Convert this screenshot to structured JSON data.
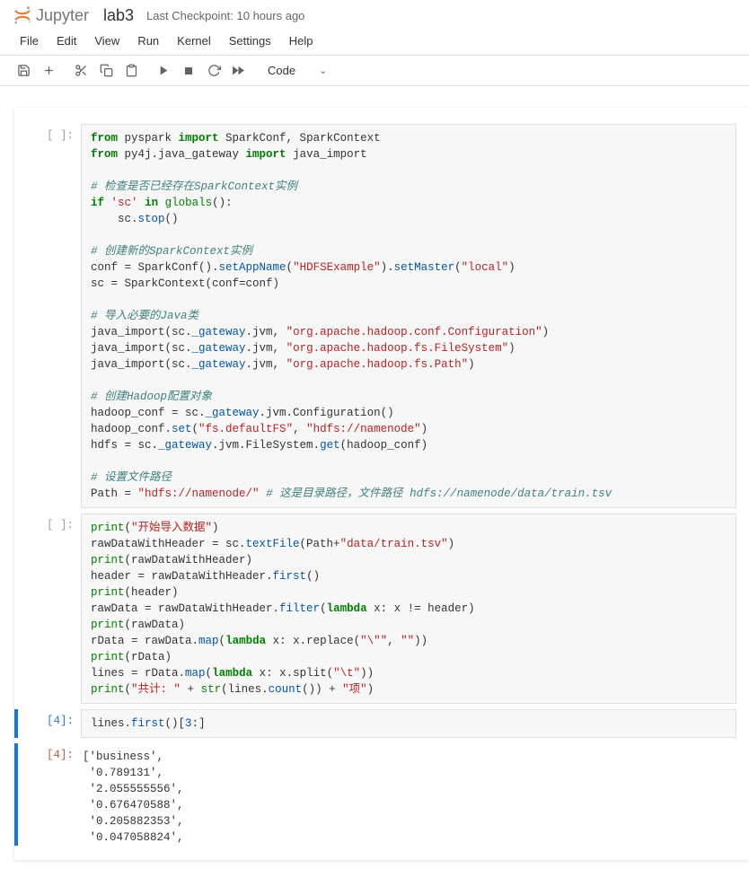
{
  "header": {
    "brand": "Jupyter",
    "doc_title": "lab3",
    "checkpoint": "Last Checkpoint: 10 hours ago"
  },
  "menu": {
    "file": "File",
    "edit": "Edit",
    "view": "View",
    "run": "Run",
    "kernel": "Kernel",
    "settings": "Settings",
    "help": "Help"
  },
  "toolbar": {
    "save": "💾",
    "add": "＋",
    "cut": "✂",
    "copy": "⧉",
    "paste": "📋",
    "run": "▶",
    "stop": "■",
    "restart": "⟳",
    "ff": "▶▶",
    "cell_type": "Code",
    "chevron": "⌄"
  },
  "cells": [
    {
      "prompt": "[ ]:",
      "type": "code",
      "lines": [
        [
          [
            "kw",
            "from"
          ],
          [
            "p",
            " pyspark "
          ],
          [
            "kw",
            "import"
          ],
          [
            "p",
            " SparkConf, SparkContext"
          ]
        ],
        [
          [
            "kw",
            "from"
          ],
          [
            "p",
            " py4j.java_gateway "
          ],
          [
            "kw",
            "import"
          ],
          [
            "p",
            " java_import"
          ]
        ],
        [
          [
            "p",
            ""
          ]
        ],
        [
          [
            "cm",
            "# 检查是否已经存在SparkContext实例"
          ]
        ],
        [
          [
            "kw",
            "if"
          ],
          [
            "p",
            " "
          ],
          [
            "str",
            "'sc'"
          ],
          [
            "p",
            " "
          ],
          [
            "kw",
            "in"
          ],
          [
            "p",
            " "
          ],
          [
            "builtin",
            "globals"
          ],
          [
            "p",
            "():"
          ]
        ],
        [
          [
            "p",
            "    sc."
          ],
          [
            "fn",
            "stop"
          ],
          [
            "p",
            "()"
          ]
        ],
        [
          [
            "p",
            ""
          ]
        ],
        [
          [
            "cm",
            "# 创建新的SparkContext实例"
          ]
        ],
        [
          [
            "p",
            "conf = SparkConf()."
          ],
          [
            "fn",
            "setAppName"
          ],
          [
            "p",
            "("
          ],
          [
            "str",
            "\"HDFSExample\""
          ],
          [
            "p",
            ")."
          ],
          [
            "fn",
            "setMaster"
          ],
          [
            "p",
            "("
          ],
          [
            "str",
            "\"local\""
          ],
          [
            "p",
            ")"
          ]
        ],
        [
          [
            "p",
            "sc = SparkContext(conf=conf)"
          ]
        ],
        [
          [
            "p",
            ""
          ]
        ],
        [
          [
            "cm",
            "# 导入必要的Java类"
          ]
        ],
        [
          [
            "p",
            "java_import(sc."
          ],
          [
            "fn",
            "_gateway"
          ],
          [
            "p",
            ".jvm, "
          ],
          [
            "str",
            "\"org.apache.hadoop.conf.Configuration\""
          ],
          [
            "p",
            ")"
          ]
        ],
        [
          [
            "p",
            "java_import(sc."
          ],
          [
            "fn",
            "_gateway"
          ],
          [
            "p",
            ".jvm, "
          ],
          [
            "str",
            "\"org.apache.hadoop.fs.FileSystem\""
          ],
          [
            "p",
            ")"
          ]
        ],
        [
          [
            "p",
            "java_import(sc."
          ],
          [
            "fn",
            "_gateway"
          ],
          [
            "p",
            ".jvm, "
          ],
          [
            "str",
            "\"org.apache.hadoop.fs.Path\""
          ],
          [
            "p",
            ")"
          ]
        ],
        [
          [
            "p",
            ""
          ]
        ],
        [
          [
            "cm",
            "# 创建Hadoop配置对象"
          ]
        ],
        [
          [
            "p",
            "hadoop_conf = sc."
          ],
          [
            "fn",
            "_gateway"
          ],
          [
            "p",
            ".jvm.Configuration()"
          ]
        ],
        [
          [
            "p",
            "hadoop_conf."
          ],
          [
            "fn",
            "set"
          ],
          [
            "p",
            "("
          ],
          [
            "str",
            "\"fs.defaultFS\""
          ],
          [
            "p",
            ", "
          ],
          [
            "str",
            "\"hdfs://namenode\""
          ],
          [
            "p",
            ")"
          ]
        ],
        [
          [
            "p",
            "hdfs = sc."
          ],
          [
            "fn",
            "_gateway"
          ],
          [
            "p",
            ".jvm.FileSystem."
          ],
          [
            "fn",
            "get"
          ],
          [
            "p",
            "(hadoop_conf)"
          ]
        ],
        [
          [
            "p",
            ""
          ]
        ],
        [
          [
            "cm",
            "# 设置文件路径"
          ]
        ],
        [
          [
            "p",
            "Path = "
          ],
          [
            "str",
            "\"hdfs://namenode/\""
          ],
          [
            "p",
            " "
          ],
          [
            "cm",
            "# 这是目录路径，文件路径 hdfs://namenode/data/train.tsv"
          ]
        ]
      ]
    },
    {
      "prompt": "[ ]:",
      "type": "code",
      "lines": [
        [
          [
            "builtin",
            "print"
          ],
          [
            "p",
            "("
          ],
          [
            "str",
            "\"开始导入数据\""
          ],
          [
            "p",
            ")"
          ]
        ],
        [
          [
            "p",
            "rawDataWithHeader = sc."
          ],
          [
            "fn",
            "textFile"
          ],
          [
            "p",
            "(Path+"
          ],
          [
            "str",
            "\"data/train.tsv\""
          ],
          [
            "p",
            ")"
          ]
        ],
        [
          [
            "builtin",
            "print"
          ],
          [
            "p",
            "(rawDataWithHeader)"
          ]
        ],
        [
          [
            "p",
            "header = rawDataWithHeader."
          ],
          [
            "fn",
            "first"
          ],
          [
            "p",
            "()"
          ]
        ],
        [
          [
            "builtin",
            "print"
          ],
          [
            "p",
            "(header)"
          ]
        ],
        [
          [
            "p",
            "rawData = rawDataWithHeader."
          ],
          [
            "fn",
            "filter"
          ],
          [
            "p",
            "("
          ],
          [
            "kw",
            "lambda"
          ],
          [
            "p",
            " x: x != header)"
          ]
        ],
        [
          [
            "builtin",
            "print"
          ],
          [
            "p",
            "(rawData)"
          ]
        ],
        [
          [
            "p",
            "rData = rawData."
          ],
          [
            "fn",
            "map"
          ],
          [
            "p",
            "("
          ],
          [
            "kw",
            "lambda"
          ],
          [
            "p",
            " x: x.replace("
          ],
          [
            "str",
            "\"\\\"\""
          ],
          [
            "p",
            ", "
          ],
          [
            "str",
            "\"\""
          ],
          [
            "p",
            "))"
          ]
        ],
        [
          [
            "builtin",
            "print"
          ],
          [
            "p",
            "(rData)"
          ]
        ],
        [
          [
            "p",
            "lines = rData."
          ],
          [
            "fn",
            "map"
          ],
          [
            "p",
            "("
          ],
          [
            "kw",
            "lambda"
          ],
          [
            "p",
            " x: x.split("
          ],
          [
            "str",
            "\"\\t\""
          ],
          [
            "p",
            "))"
          ]
        ],
        [
          [
            "builtin",
            "print"
          ],
          [
            "p",
            "("
          ],
          [
            "str",
            "\"共计: \""
          ],
          [
            "p",
            " + "
          ],
          [
            "builtin",
            "str"
          ],
          [
            "p",
            "(lines."
          ],
          [
            "fn",
            "count"
          ],
          [
            "p",
            "()) + "
          ],
          [
            "str",
            "\"项\""
          ],
          [
            "p",
            ")"
          ]
        ]
      ]
    },
    {
      "prompt": "[4]:",
      "type": "code",
      "active": true,
      "lines": [
        [
          [
            "p",
            "lines."
          ],
          [
            "fn",
            "first"
          ],
          [
            "p",
            "()["
          ],
          [
            "num",
            "3"
          ],
          [
            "p",
            ":]"
          ]
        ]
      ]
    },
    {
      "prompt": "[4]:",
      "type": "output",
      "active": true,
      "text": "['business',\n '0.789131',\n '2.055555556',\n '0.676470588',\n '0.205882353',\n '0.047058824',"
    }
  ]
}
